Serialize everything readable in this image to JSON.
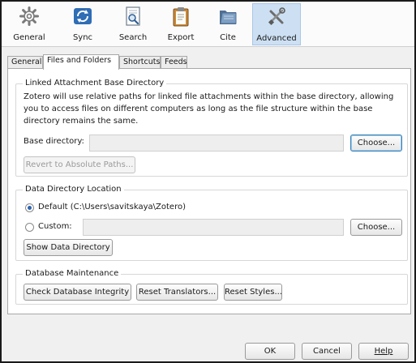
{
  "toolbar": {
    "panes": [
      {
        "label": "General",
        "icon": "gear-icon"
      },
      {
        "label": "Sync",
        "icon": "sync-arrows-icon"
      },
      {
        "label": "Search",
        "icon": "magnifier-document-icon"
      },
      {
        "label": "Export",
        "icon": "clipboard-icon"
      },
      {
        "label": "Cite",
        "icon": "folder-icon"
      },
      {
        "label": "Advanced",
        "icon": "tools-icon"
      }
    ],
    "selected": "Advanced"
  },
  "subtabs": [
    "General",
    "Files and Folders",
    "Shortcuts",
    "Feeds"
  ],
  "active_subtab": "Files and Folders",
  "linked": {
    "caption": "Linked Attachment Base Directory",
    "description": "Zotero will use relative paths for linked file attachments within the base directory, allowing you to access files on different computers as long as the file structure within the base directory remains the same.",
    "base_dir_label": "Base directory:",
    "base_dir_value": "",
    "choose_label": "Choose...",
    "revert_label": "Revert to Absolute Paths..."
  },
  "data_dir": {
    "caption": "Data Directory Location",
    "default_label": "Default (C:\\Users\\savitskaya\\Zotero)",
    "custom_label": "Custom:",
    "custom_value": "",
    "choose_label": "Choose...",
    "show_label": "Show Data Directory",
    "selected_option": "default"
  },
  "maintenance": {
    "caption": "Database Maintenance",
    "check_label": "Check Database Integrity",
    "reset_translators_label": "Reset Translators...",
    "reset_styles_label": "Reset Styles..."
  },
  "footer": {
    "ok_label": "OK",
    "cancel_label": "Cancel",
    "help_label": "Help"
  }
}
